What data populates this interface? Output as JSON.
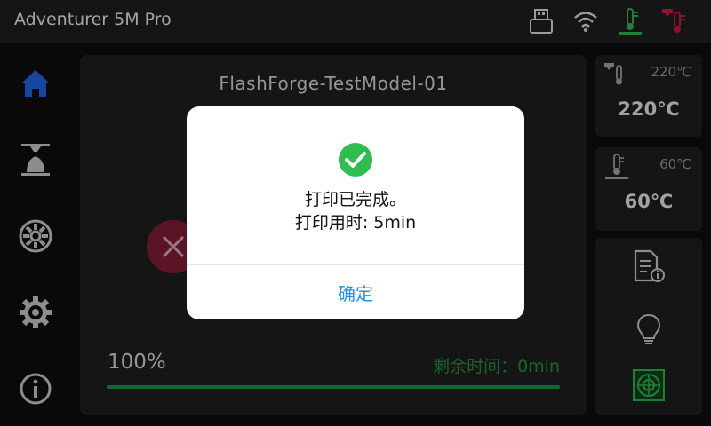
{
  "header": {
    "title": "Adventurer 5M Pro",
    "icons": [
      "usb-icon",
      "wifi-icon",
      "bed-temp-icon",
      "nozzle-temp-icon"
    ],
    "colors": {
      "bed_temp_icon": "#2aa84a",
      "nozzle_temp_icon": "#c0163c"
    }
  },
  "sidebar": {
    "items": [
      {
        "name": "home",
        "icon": "home-icon",
        "active": true
      },
      {
        "name": "print",
        "icon": "printer-icon"
      },
      {
        "name": "filament",
        "icon": "filament-spool-icon"
      },
      {
        "name": "settings",
        "icon": "gear-icon"
      },
      {
        "name": "about",
        "icon": "info-icon"
      }
    ],
    "active_color": "#1f5fd6"
  },
  "job": {
    "model_name": "FlashForge-TestModel-01",
    "progress_label": "100%",
    "progress_fraction": 1.0,
    "remaining": "剩余时间：0min",
    "progress_color": "#1f8a36"
  },
  "temps": {
    "nozzle": {
      "current": "220℃",
      "target": "220℃"
    },
    "bed": {
      "current": "60℃",
      "target": "60℃"
    }
  },
  "tools": [
    "file-details-icon",
    "light-bulb-icon",
    "camera-fan-icon"
  ],
  "dialog": {
    "line1": "打印已完成。",
    "line2": "打印用时: 5min",
    "confirm": "确定",
    "accent": "#2b8fe0",
    "check_color": "#2ebd4f"
  }
}
